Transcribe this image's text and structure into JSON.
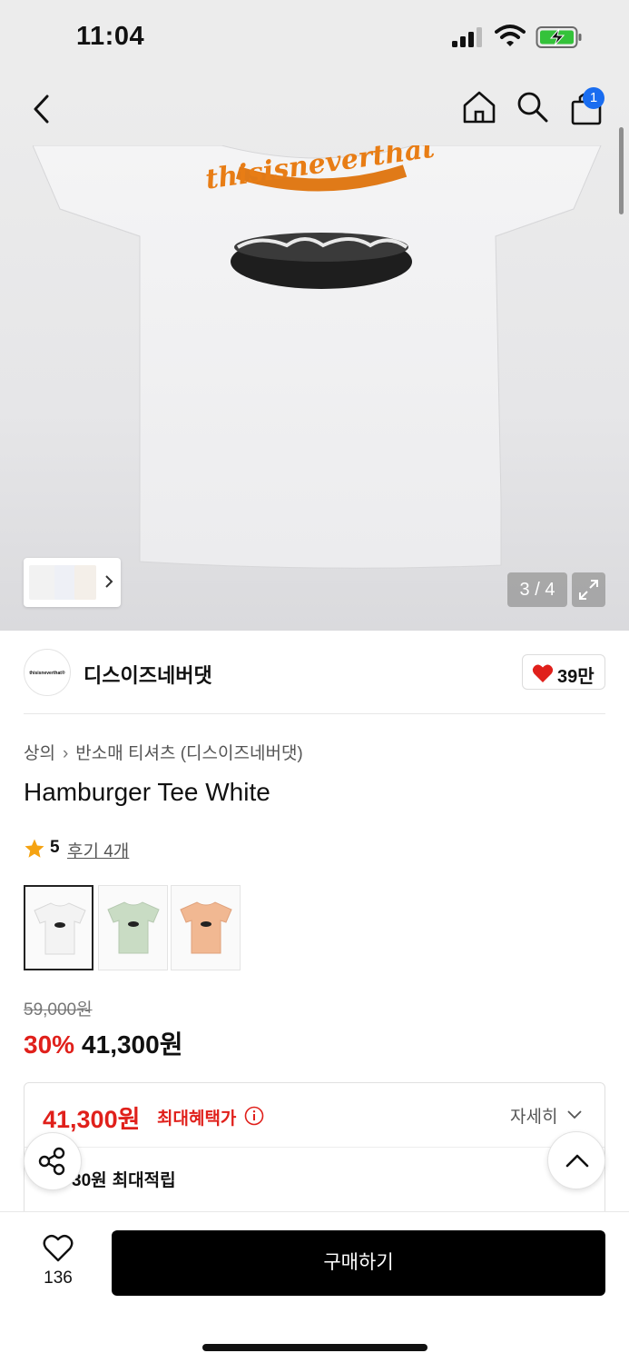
{
  "status_bar": {
    "time": "11:04"
  },
  "header": {
    "cart_count": "1"
  },
  "gallery": {
    "counter": "3 / 4",
    "tee_print_text": "thisisneverthat"
  },
  "brand": {
    "logo_text": "thisisneverthat®",
    "name": "디스이즈네버댓",
    "likes": "39만"
  },
  "breadcrumb": {
    "category": "상의",
    "subcategory": "반소매 티셔츠 (디스이즈네버댓)"
  },
  "product": {
    "title": "Hamburger Tee White",
    "rating": "5",
    "reviews": "후기 4개",
    "colors": [
      {
        "name": "White",
        "hex": "#f3f3f3"
      },
      {
        "name": "Mint",
        "hex": "#c9dcc4"
      },
      {
        "name": "Peach",
        "hex": "#f1b892"
      }
    ]
  },
  "price": {
    "original": "59,000원",
    "discount": "30%",
    "sale": "41,300원"
  },
  "benefit": {
    "price": "41,300원",
    "label": "최대혜택가",
    "detail": "자세히",
    "points_amount": "30원",
    "points_label": "최대적립"
  },
  "bottom_bar": {
    "wish_count": "136",
    "buy_label": "구매하기"
  },
  "colors": {
    "accent_red": "#e0201b",
    "badge_blue": "#1a6df0",
    "button_black": "#000000"
  }
}
